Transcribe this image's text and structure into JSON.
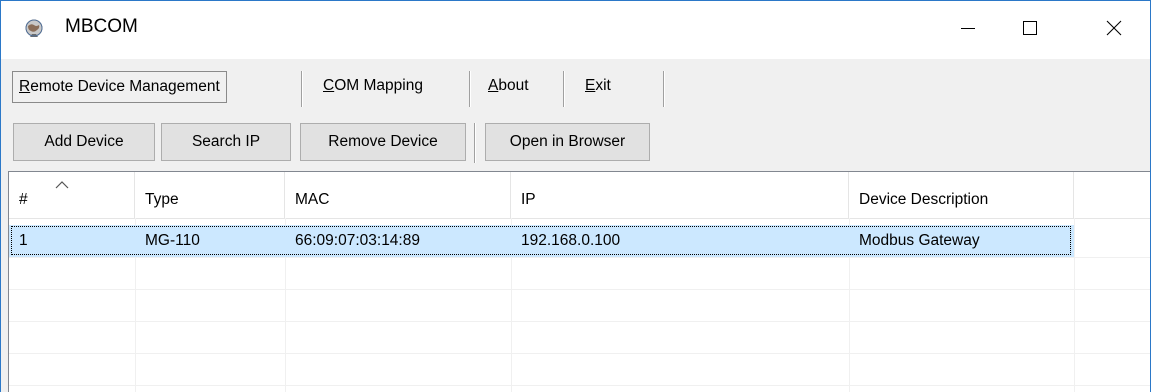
{
  "window": {
    "title": "MBCOM",
    "app_icon": "globe-icon",
    "controls": {
      "minimize": "minimize-icon",
      "maximize": "maximize-icon",
      "close": "close-icon"
    }
  },
  "menu": {
    "items": [
      {
        "label_mnemonic": "R",
        "label_rest": "emote Device Management",
        "active": true
      },
      {
        "label_mnemonic": "C",
        "label_rest": "OM Mapping",
        "active": false
      },
      {
        "label_mnemonic": "A",
        "label_rest": "bout",
        "active": false
      },
      {
        "label_mnemonic": "E",
        "label_rest": "xit",
        "active": false
      }
    ]
  },
  "toolbar": {
    "add_device": "Add Device",
    "search_ip": "Search IP",
    "remove_device": "Remove Device",
    "open_in_browser": "Open in Browser"
  },
  "table": {
    "columns": [
      "#",
      "Type",
      "MAC",
      "IP",
      "Device Description"
    ],
    "sort_indicator": "sort-ascending-icon",
    "rows": [
      {
        "num": "1",
        "type": "MG-110",
        "mac": "66:09:07:03:14:89",
        "ip": "192.168.0.100",
        "description": "Modbus Gateway",
        "selected": true
      }
    ]
  },
  "colors": {
    "selection": "#cce8ff",
    "window_border": "#2b78c8",
    "chrome": "#f0f0f0"
  }
}
